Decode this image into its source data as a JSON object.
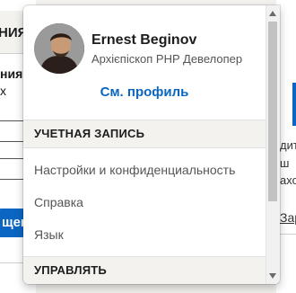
{
  "background": {
    "left_heading": "НИЯ",
    "left_line1": "ния",
    "left_line2": "х",
    "left_button": "щен",
    "right_line1": "дит",
    "right_line2": "ш",
    "right_line3": "ахо",
    "right_link": "Зар"
  },
  "profile": {
    "name": "Ernest Beginov",
    "headline": "Архієпіскоп PHP Девелопер",
    "view_profile": "См. профиль"
  },
  "sections": {
    "account": {
      "title": "УЧЕТНАЯ ЗАПИСЬ",
      "items": [
        "Настройки и конфиденциальность",
        "Справка",
        "Язык"
      ]
    },
    "manage": {
      "title": "УПРАВЛЯТЬ"
    }
  },
  "colors": {
    "accent": "#0a66c2",
    "section_bg": "#f3f2ef",
    "muted_text": "#555555"
  },
  "icons": {
    "scroll_up": "triangle-up",
    "scroll_down": "triangle-down"
  }
}
